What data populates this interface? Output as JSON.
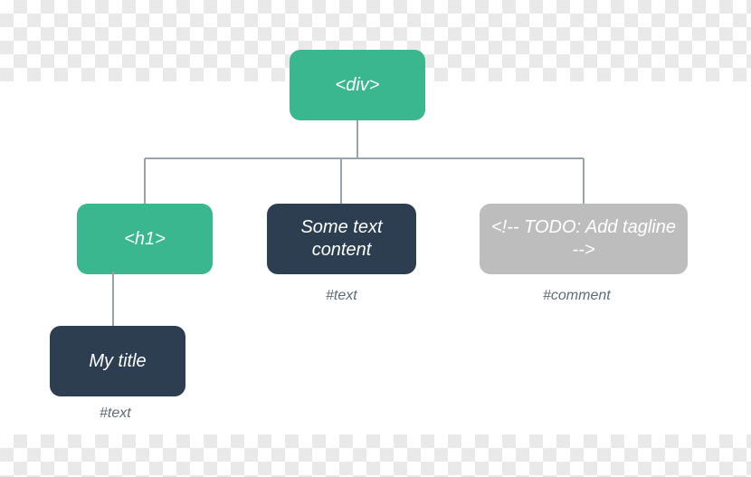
{
  "diagram": {
    "root": {
      "label": "<div>"
    },
    "children": [
      {
        "label": "<h1>",
        "caption": ""
      },
      {
        "label": "Some text content",
        "caption": "#text"
      },
      {
        "label": "<!-- TODO: Add tagline  -->",
        "caption": "#comment"
      }
    ],
    "grandchild": {
      "label": "My title",
      "caption": "#text"
    }
  },
  "colors": {
    "green": "#3bb78f",
    "dark": "#2c3e50",
    "grey": "#bdbdbd",
    "line": "#9aa3a9"
  }
}
